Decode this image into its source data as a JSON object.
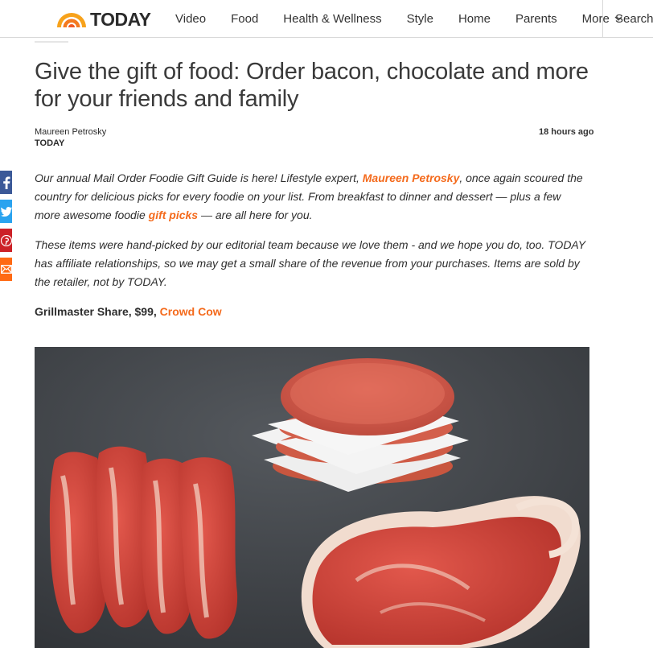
{
  "brand": {
    "name": "TODAY"
  },
  "nav": {
    "items": [
      "Video",
      "Food",
      "Health & Wellness",
      "Style",
      "Home",
      "Parents"
    ],
    "more_label": "More",
    "search_label": "Search"
  },
  "article": {
    "headline": "Give the gift of food: Order bacon, chocolate and more for your friends and family",
    "author": "Maureen Petrosky",
    "outlet": "TODAY",
    "timestamp": "18 hours ago",
    "p1": {
      "a": "Our annual Mail Order Foodie Gift Guide is here! Lifestyle expert, ",
      "link1": "Maureen Petrosky",
      "b": ", once again scoured the country for delicious picks for every foodie on your list. From breakfast to dinner and dessert — plus a few more awesome foodie ",
      "link2": "gift picks",
      "c": " — are all here for you."
    },
    "p2": "These items were hand-picked by our editorial team because we love them - and we hope you do, too. TODAY has affiliate relationships, so we may get a small share of the revenue from your purchases. Items are sold by the retailer, not by TODAY.",
    "item": {
      "name": "Grillmaster Share, $99, ",
      "retailer": "Crowd Cow"
    }
  },
  "share": [
    "facebook-icon",
    "twitter-icon",
    "pinterest-icon",
    "email-icon"
  ],
  "colors": {
    "accent": "#f46a1c",
    "facebook": "#3b5998",
    "twitter": "#2aa3ef",
    "pinterest": "#cc2127",
    "email": "#ff6a13"
  }
}
